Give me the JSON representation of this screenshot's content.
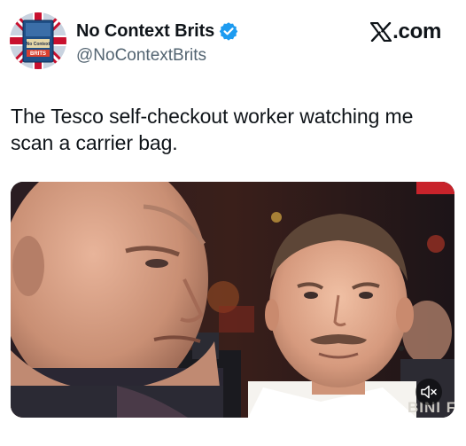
{
  "author": {
    "display_name": "No Context Brits",
    "handle": "@NoContextBrits",
    "verified": true,
    "avatar_icon": "book-cover-avatar-icon",
    "avatar_text": [
      "No Context",
      "BRITS"
    ]
  },
  "brand": {
    "label": ".com",
    "logo_icon": "x-logo-icon"
  },
  "tweet": {
    "text": "The Tesco self-checkout worker watching me scan a carrier bag."
  },
  "media": {
    "type": "video",
    "scene_icon": "two-boxers-stare-image",
    "overlay_text": "BINI FIG",
    "mute_icon": "speaker-muted-icon"
  },
  "colors": {
    "verified_blue": "#1d9bf0",
    "handle_gray": "#536471",
    "text": "#0f1419"
  }
}
